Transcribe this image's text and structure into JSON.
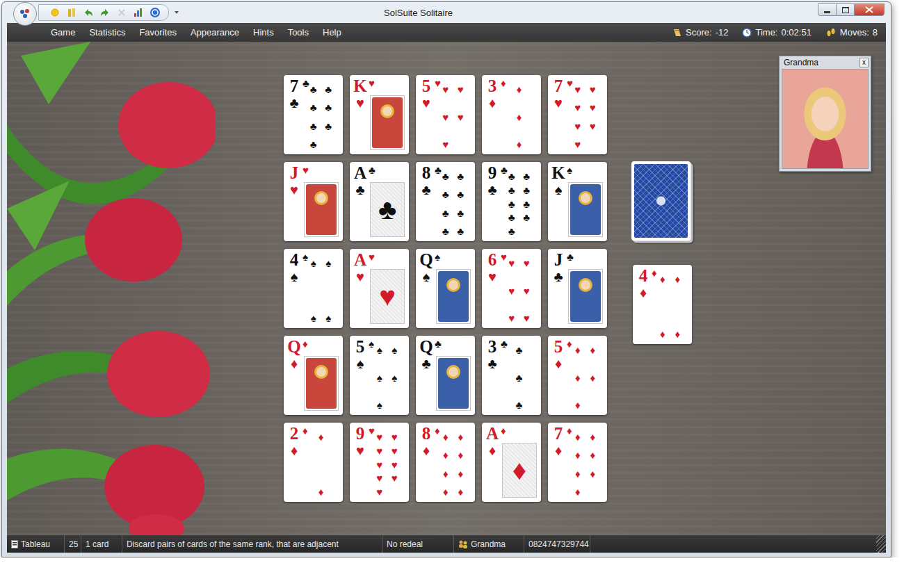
{
  "window": {
    "title": "SolSuite Solitaire"
  },
  "toolbar": [
    {
      "kind": "new",
      "disabled": false
    },
    {
      "kind": "cards",
      "disabled": false
    },
    {
      "kind": "undo",
      "disabled": false
    },
    {
      "kind": "redo",
      "disabled": false
    },
    {
      "kind": "cancel",
      "disabled": true
    },
    {
      "kind": "stats",
      "disabled": false
    },
    {
      "kind": "help",
      "disabled": false
    }
  ],
  "menu": [
    {
      "label": "Game"
    },
    {
      "label": "Statistics"
    },
    {
      "label": "Favorites"
    },
    {
      "label": "Appearance"
    },
    {
      "label": "Hints"
    },
    {
      "label": "Tools"
    },
    {
      "label": "Help"
    }
  ],
  "stats": [
    {
      "label": "Score:",
      "value": "-12",
      "kind": "score"
    },
    {
      "label": "Time:",
      "value": "0:02:51",
      "kind": "time"
    },
    {
      "label": "Moves:",
      "value": "8",
      "kind": "moves"
    }
  ],
  "tableau": [
    [
      {
        "rank": "7",
        "suit": "♣",
        "kind": "pips"
      },
      {
        "rank": "K",
        "suit": "♥",
        "kind": "face"
      },
      {
        "rank": "5",
        "suit": "♥",
        "kind": "pips"
      },
      {
        "rank": "3",
        "suit": "♦",
        "kind": "pips"
      },
      {
        "rank": "7",
        "suit": "♥",
        "kind": "pips"
      }
    ],
    [
      {
        "rank": "J",
        "suit": "♥",
        "kind": "face"
      },
      {
        "rank": "A",
        "suit": "♣",
        "kind": "ace"
      },
      {
        "rank": "8",
        "suit": "♣",
        "kind": "pips"
      },
      {
        "rank": "9",
        "suit": "♣",
        "kind": "pips"
      },
      {
        "rank": "K",
        "suit": "♠",
        "kind": "face"
      }
    ],
    [
      {
        "rank": "4",
        "suit": "♠",
        "kind": "pips"
      },
      {
        "rank": "A",
        "suit": "♥",
        "kind": "ace"
      },
      {
        "rank": "Q",
        "suit": "♠",
        "kind": "face"
      },
      {
        "rank": "6",
        "suit": "♥",
        "kind": "pips"
      },
      {
        "rank": "J",
        "suit": "♣",
        "kind": "face"
      }
    ],
    [
      {
        "rank": "Q",
        "suit": "♦",
        "kind": "face"
      },
      {
        "rank": "5",
        "suit": "♠",
        "kind": "pips"
      },
      {
        "rank": "Q",
        "suit": "♣",
        "kind": "face"
      },
      {
        "rank": "3",
        "suit": "♣",
        "kind": "pips"
      },
      {
        "rank": "5",
        "suit": "♦",
        "kind": "pips"
      }
    ],
    [
      {
        "rank": "2",
        "suit": "♦",
        "kind": "pips"
      },
      {
        "rank": "9",
        "suit": "♥",
        "kind": "pips"
      },
      {
        "rank": "8",
        "suit": "♦",
        "kind": "pips"
      },
      {
        "rank": "A",
        "suit": "♦",
        "kind": "ace"
      },
      {
        "rank": "7",
        "suit": "♦",
        "kind": "pips"
      }
    ]
  ],
  "stock": {
    "face_down": true
  },
  "waste": {
    "rank": "4",
    "suit": "♦",
    "kind": "pips"
  },
  "opponent": {
    "title": "Grandma",
    "close": "x"
  },
  "status_bar": [
    {
      "text": "Tableau",
      "kind": "card"
    },
    {
      "text": "25",
      "kind": "text"
    },
    {
      "text": "1 card",
      "kind": "text"
    },
    {
      "text": "Discard pairs of cards of the same rank, that are adjacent",
      "kind": "text"
    },
    {
      "text": "No redeal",
      "kind": "text"
    },
    {
      "text": "Grandma",
      "kind": "player"
    },
    {
      "text": "0824747329744",
      "kind": "text"
    }
  ]
}
